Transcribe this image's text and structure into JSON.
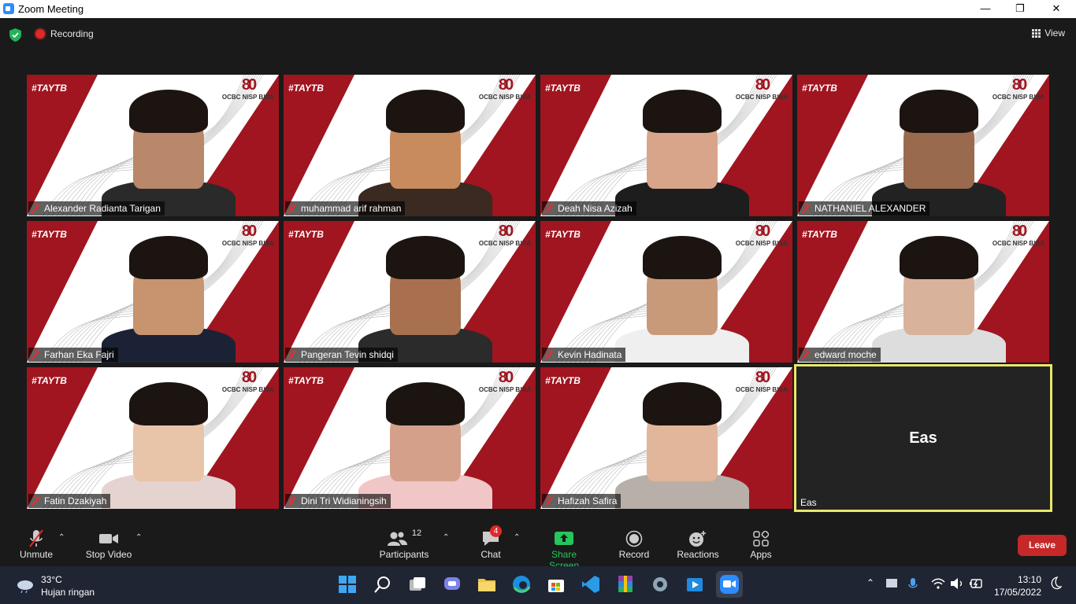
{
  "window": {
    "title": "Zoom Meeting",
    "minimize": "—",
    "maximize": "❐",
    "close": "✕"
  },
  "topbar": {
    "recording_label": "Recording",
    "view_label": "View"
  },
  "tiles": [
    {
      "name": "Alexander Radianta Tarigan"
    },
    {
      "name": "muhammad arif rahman"
    },
    {
      "name": "Deah Nisa Azizah"
    },
    {
      "name": "NATHANIEL ALEXANDER"
    },
    {
      "name": "Farhan Eka Fajri"
    },
    {
      "name": "Pangeran Tevin shidqi"
    },
    {
      "name": "Kevin Hadinata"
    },
    {
      "name": "edward moche"
    },
    {
      "name": "Fatin Dzakiyah"
    },
    {
      "name": "Dini Tri Widianingsih"
    },
    {
      "name": "Hafizah Safira"
    },
    {
      "name": "Eas",
      "center_label": "Eas"
    }
  ],
  "background": {
    "hashtag": "#TAYTB",
    "logo": "80",
    "brand": "OCBC NISP B!SA"
  },
  "toolbar": {
    "unmute": "Unmute",
    "stop_video": "Stop Video",
    "participants": "Participants",
    "participants_count": "12",
    "chat": "Chat",
    "chat_badge": "4",
    "share_screen": "Share Screen",
    "record": "Record",
    "reactions": "Reactions",
    "apps": "Apps",
    "leave": "Leave"
  },
  "taskbar": {
    "temperature": "33°C",
    "weather": "Hujan ringan",
    "time": "13:10",
    "date": "17/05/2022"
  },
  "colors": {
    "accent_red": "#a01520",
    "share_green": "#25c65a",
    "active_speaker": "#e6e86a",
    "leave": "#c62828"
  }
}
